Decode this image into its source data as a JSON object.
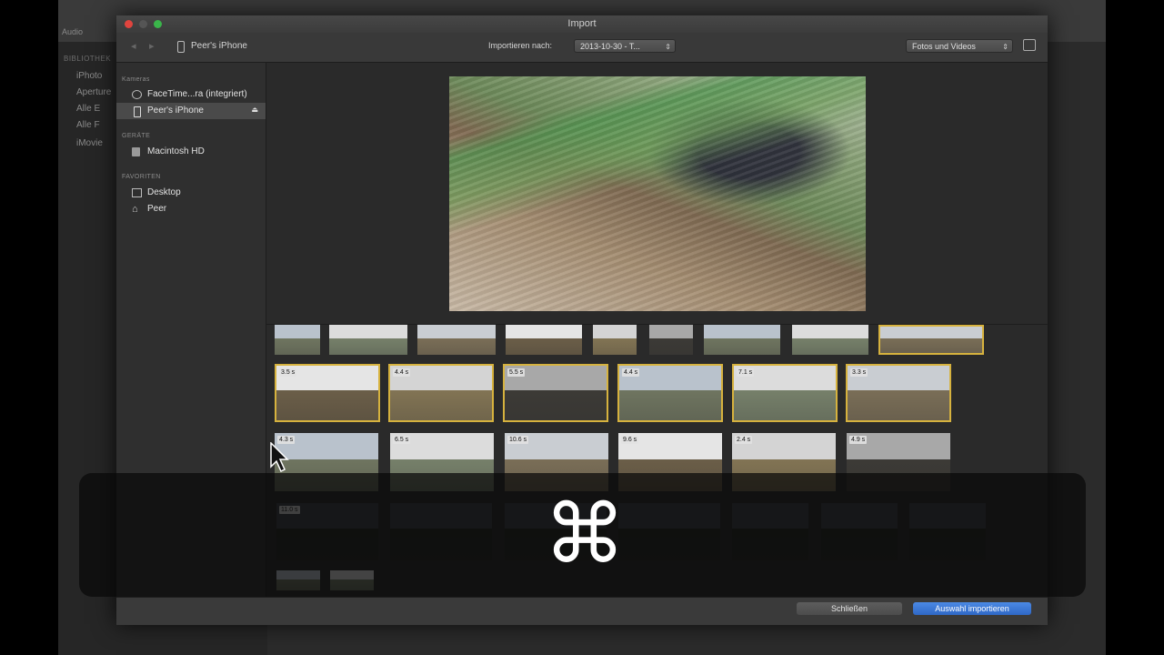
{
  "background_app": {
    "tab_label": "Audio",
    "sidebar_section": "BIBLIOTHEK",
    "sidebar_items": [
      "iPhoto",
      "Aperture",
      "Alle E",
      "Alle F",
      "iMovie"
    ]
  },
  "dialog": {
    "title": "Import",
    "toolbar": {
      "back_icon": "chevron-left-icon",
      "forward_icon": "chevron-right-icon",
      "device_name": "Peer's iPhone",
      "import_to_label": "Importieren nach:",
      "import_to_value": "2013-10-30 - T...",
      "filter_value": "Fotos und Videos"
    },
    "sidebar": {
      "sections": [
        {
          "label": "Kameras",
          "items": [
            {
              "label": "FaceTime...ra (integriert)",
              "icon": "camera-icon"
            },
            {
              "label": "Peer's iPhone",
              "icon": "phone-icon",
              "selected": true
            }
          ]
        },
        {
          "label": "GERÄTE",
          "items": [
            {
              "label": "Macintosh HD",
              "icon": "disk-icon"
            }
          ]
        },
        {
          "label": "FAVORITEN",
          "items": [
            {
              "label": "Desktop",
              "icon": "desktop-icon"
            },
            {
              "label": "Peer",
              "icon": "home-icon"
            }
          ]
        }
      ]
    },
    "clip_rows": [
      {
        "clips": [
          {
            "duration": "",
            "selected": false
          },
          {
            "duration": "",
            "selected": false
          },
          {
            "duration": "",
            "selected": false
          },
          {
            "duration": "",
            "selected": false
          },
          {
            "duration": "",
            "selected": false
          },
          {
            "duration": "",
            "selected": false
          },
          {
            "duration": "",
            "selected": false
          },
          {
            "duration": "",
            "selected": false
          },
          {
            "duration": "",
            "selected": true
          }
        ]
      },
      {
        "clips": [
          {
            "duration": "3.5 s",
            "selected": true
          },
          {
            "duration": "4.4 s",
            "selected": true
          },
          {
            "duration": "5.5 s",
            "selected": true
          },
          {
            "duration": "4.4 s",
            "selected": true
          },
          {
            "duration": "7.1 s",
            "selected": true
          },
          {
            "duration": "3.3 s",
            "selected": true
          }
        ]
      },
      {
        "clips": [
          {
            "duration": "4.3 s",
            "selected": false
          },
          {
            "duration": "6.5 s",
            "selected": false
          },
          {
            "duration": "10.6 s",
            "selected": false
          },
          {
            "duration": "9.6 s",
            "selected": false
          },
          {
            "duration": "2.4 s",
            "selected": false
          },
          {
            "duration": "4.9 s",
            "selected": false
          }
        ]
      },
      {
        "clips": [
          {
            "duration": "11.0 s",
            "selected": false
          },
          {
            "duration": "",
            "selected": false
          },
          {
            "duration": "",
            "selected": false
          },
          {
            "duration": "",
            "selected": false
          },
          {
            "duration": "",
            "selected": false
          },
          {
            "duration": "",
            "selected": false
          },
          {
            "duration": "",
            "selected": false
          }
        ]
      },
      {
        "clips": [
          {
            "duration": "",
            "selected": false
          },
          {
            "duration": "",
            "selected": false
          }
        ]
      }
    ],
    "buttons": {
      "close": "Schließen",
      "import_selection": "Auswahl importieren"
    }
  },
  "overlay": {
    "key_symbol": "⌘"
  },
  "colors": {
    "accent_blue": "#3a78d8",
    "selection_gold": "#d6b23e",
    "dialog_bg": "#2a2a2a"
  }
}
